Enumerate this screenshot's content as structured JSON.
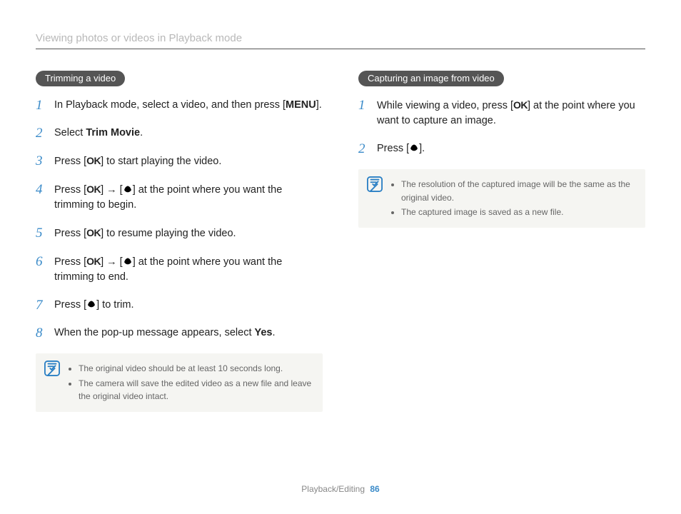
{
  "header": "Viewing photos or videos in Playback mode",
  "left": {
    "pill": "Trimming a video",
    "steps": [
      {
        "pre": "In Playback mode, select a video, and then press [",
        "key": "MENU",
        "post": "]."
      },
      {
        "pre": "Select ",
        "bold": "Trim Movie",
        "post": "."
      },
      {
        "pre": "Press [",
        "ok": true,
        "post": "] to start playing the video."
      },
      {
        "pre": "Press [",
        "ok_arrow_macro": true,
        "post": "] at the point where you want the trimming to begin."
      },
      {
        "pre": "Press [",
        "ok": true,
        "post": "] to resume playing the video."
      },
      {
        "pre": "Press [",
        "ok_arrow_macro": true,
        "post": "] at the point where you want the trimming to end."
      },
      {
        "pre": "Press [",
        "macro": true,
        "post": "] to trim."
      },
      {
        "pre": "When the pop-up message appears, select ",
        "bold": "Yes",
        "post": "."
      }
    ],
    "notes": [
      "The original video should be at least 10 seconds long.",
      "The camera will save the edited video as a new file and leave the original video intact."
    ]
  },
  "right": {
    "pill": "Capturing an image from video",
    "steps": [
      {
        "pre": "While viewing a video, press [",
        "ok": true,
        "post": "] at the point where you want to capture an image."
      },
      {
        "pre": "Press [",
        "macro": true,
        "post": "]."
      }
    ],
    "notes": [
      "The resolution of the captured image will be the same as the original video.",
      "The captured image is saved as a new file."
    ]
  },
  "footer": {
    "section": "Playback/Editing",
    "page": "86"
  },
  "glyphs": {
    "ok": "OK"
  }
}
